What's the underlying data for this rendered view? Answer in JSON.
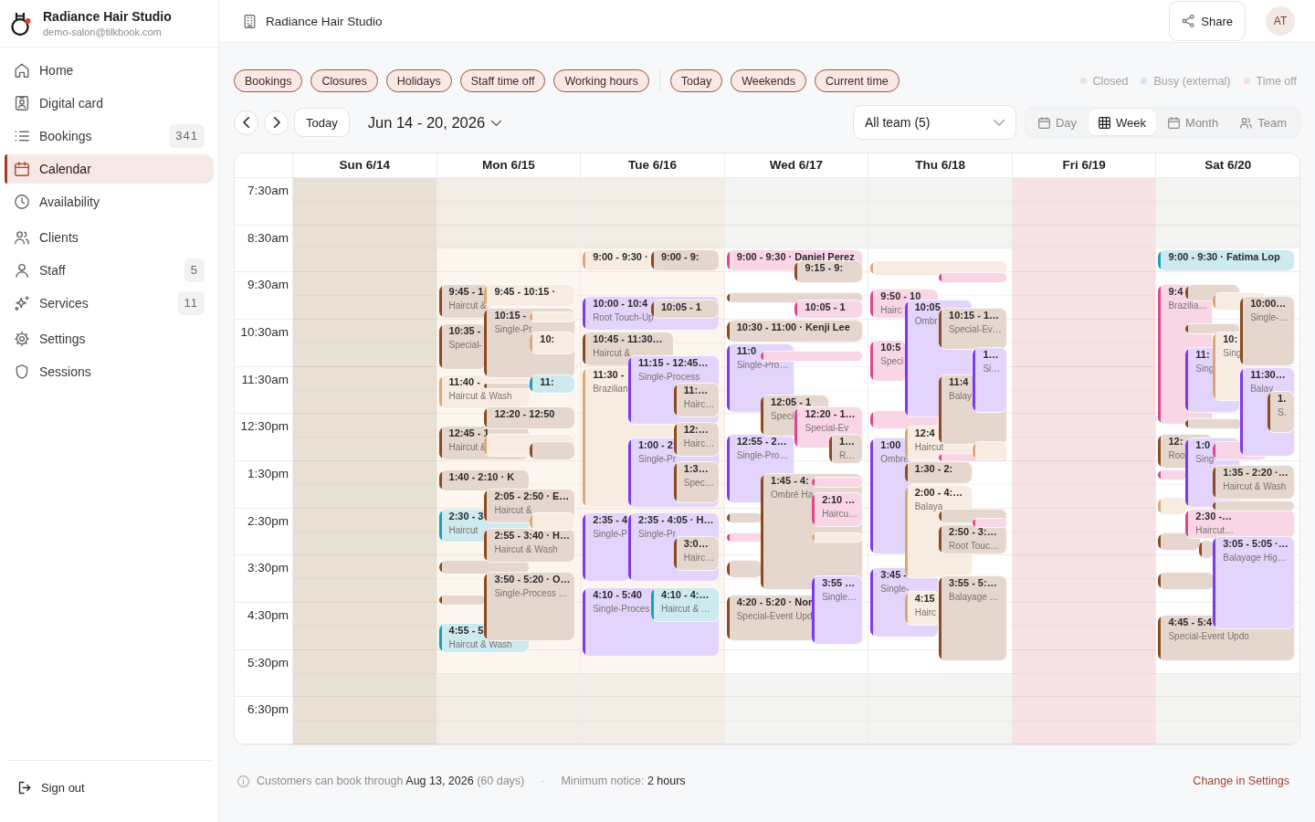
{
  "sidebar": {
    "brand": {
      "name": "Radiance Hair Studio",
      "email": "demo-salon@tilkbook.com"
    },
    "nav_groups": [
      {
        "items": [
          {
            "label": "Home",
            "selected": false
          },
          {
            "label": "Digital card",
            "selected": false
          },
          {
            "label": "Bookings",
            "count": "341",
            "selected": false
          },
          {
            "label": "Calendar",
            "selected": true
          },
          {
            "label": "Availability",
            "selected": false
          }
        ]
      },
      {
        "items": [
          {
            "label": "Clients",
            "selected": false
          },
          {
            "label": "Staff",
            "count": "5",
            "selected": false
          },
          {
            "label": "Services",
            "count": "11",
            "selected": false
          }
        ]
      },
      {
        "items": [
          {
            "label": "Settings",
            "selected": false
          },
          {
            "label": "Sessions",
            "selected": false
          }
        ]
      }
    ],
    "sign_out": "Sign out"
  },
  "topbar": {
    "title": "Radiance Hair Studio",
    "share": "Share",
    "avatar": "AT"
  },
  "filters": {
    "layers": [
      {
        "label": "Bookings",
        "on": true
      },
      {
        "label": "Closures",
        "on": true
      },
      {
        "label": "Holidays",
        "on": true
      },
      {
        "label": "Staff time off",
        "on": true
      },
      {
        "label": "Working hours",
        "on": true
      }
    ],
    "display": [
      {
        "label": "Today",
        "on": true
      },
      {
        "label": "Weekends",
        "on": true
      },
      {
        "label": "Current time",
        "on": true
      }
    ],
    "legend": [
      {
        "label": "Closed",
        "color": "#ebe4d9"
      },
      {
        "label": "Busy (external)",
        "color": "#d8e3f6"
      },
      {
        "label": "Time off",
        "color": "#f7dce2"
      }
    ]
  },
  "toolbar": {
    "today": "Today",
    "range": "Jun 14 - 20, 2026",
    "team": "All team (5)",
    "views": [
      {
        "label": "Day",
        "selected": false
      },
      {
        "label": "Week",
        "selected": true
      },
      {
        "label": "Month",
        "selected": false
      },
      {
        "label": "Team",
        "selected": false
      }
    ]
  },
  "calendar": {
    "time_slots": [
      "7:30am",
      "8:30am",
      "9:30am",
      "10:30am",
      "11:30am",
      "12:30pm",
      "1:30pm",
      "2:30pm",
      "3:30pm",
      "4:30pm",
      "5:30pm",
      "6:30pm"
    ],
    "days": [
      {
        "label": "Sun 6/14",
        "kind": "closed"
      },
      {
        "label": "Mon 6/15",
        "kind": "tinted",
        "events": [
          {
            "time": "9:45 - 1",
            "service": "Haircut &",
            "color": "#8b4a1f"
          },
          {
            "time": "9:45 - 10:15 ·",
            "color": "#d9a877"
          },
          {
            "time": "10:15 -",
            "service": "Single-Pr",
            "color": "#8b4a1f"
          },
          {
            "color": "#d9a877"
          },
          {
            "time": "10:35 -",
            "service": "Special-",
            "color": "#8b4a1f"
          },
          {
            "time": "10:",
            "color": "#d9a877"
          },
          {
            "time": "11:40 -",
            "service": "Haircut & Wash",
            "color": "#d9a877"
          },
          {
            "time": "11:",
            "color": "#1a9fb5"
          },
          {
            "color": "#8b4a1f"
          },
          {
            "time": "12:20 - 12:50",
            "color": "#8b4a1f"
          },
          {
            "time": "12:45 - 1",
            "service": "Haircut &",
            "color": "#8b4a1f"
          },
          {
            "color": "#d9a877"
          },
          {
            "color": "#8b4a1f"
          },
          {
            "time": "1:40 - 2:10 · K",
            "color": "#8b4a1f"
          },
          {
            "time": "2:05 - 2:50 · E…",
            "service": "Haircut &",
            "color": "#8b4a1f"
          },
          {
            "time": "2:30 - 3",
            "service": "Haircut",
            "color": "#1a9fb5"
          },
          {
            "color": "#d9a877"
          },
          {
            "time": "2:55 - 3:40 · H…",
            "service": "Haircut & Wash",
            "color": "#8b4a1f"
          },
          {
            "color": "#8b4a1f"
          },
          {
            "time": "3:50 - 5:20 · O…",
            "service": "Single-Process …",
            "color": "#8b4a1f"
          },
          {
            "color": "#8b4a1f"
          },
          {
            "time": "4:55 - 5",
            "service": "Haircut & Wash",
            "color": "#1a9fb5"
          }
        ]
      },
      {
        "label": "Tue 6/16",
        "kind": "tinted",
        "events": [
          {
            "time": "9:00 - 9:30 ·",
            "color": "#d9a877"
          },
          {
            "time": "9:00 - 9:",
            "color": "#8b4a1f"
          },
          {
            "time": "10:00 - 10:4",
            "service": "Root Touch-Up",
            "color": "#7c3aed"
          },
          {
            "time": "10:05 - 1",
            "color": "#8b4a1f"
          },
          {
            "time": "10:45 - 11:30…",
            "service": "Haircut &",
            "color": "#8b4a1f"
          },
          {
            "time": "11:15 - 12:45…",
            "service": "Single-Process",
            "color": "#7c3aed"
          },
          {
            "time": "11:30 -",
            "service": "Brazilian",
            "color": "#d9a877"
          },
          {
            "time": "11:…",
            "service": "Hairc…",
            "color": "#8b4a1f"
          },
          {
            "time": "12:…",
            "service": "Hairc…",
            "color": "#8b4a1f"
          },
          {
            "time": "1:00 - 2",
            "service": "Single-Pr",
            "color": "#7c3aed"
          },
          {
            "time": "1:3…",
            "service": "Spec…",
            "color": "#8b4a1f"
          },
          {
            "time": "2:35 - 4",
            "service": "Single-P",
            "color": "#7c3aed"
          },
          {
            "time": "2:35 - 4:05 · H…",
            "service": "Single-Pr",
            "color": "#7c3aed"
          },
          {
            "time": "3:0…",
            "service": "Hairc…",
            "color": "#8b4a1f"
          },
          {
            "time": "4:10 - 5:40",
            "service": "Single-Proces",
            "color": "#7c3aed"
          },
          {
            "time": "4:10 - 4:…",
            "service": "Haircut & …",
            "color": "#1a9fb5"
          }
        ]
      },
      {
        "label": "Wed 6/17",
        "kind": "open",
        "events": [
          {
            "time": "9:00 - 9:30 · Daniel Perez",
            "color": "#e0458d"
          },
          {
            "time": "9:15 - 9:",
            "color": "#8b4a1f"
          },
          {
            "color": "#8b4a1f"
          },
          {
            "time": "10:05 - 1",
            "color": "#e0458d"
          },
          {
            "time": "10:30 - 11:00 · Kenji Lee",
            "color": "#8b4a1f"
          },
          {
            "time": "11:0",
            "service": "Single-Pro…",
            "color": "#7c3aed"
          },
          {
            "color": "#e0458d"
          },
          {
            "time": "12:05 - 1",
            "service": "Speci",
            "color": "#8b4a1f"
          },
          {
            "time": "12:20 - 1…",
            "service": "Special-Ev",
            "color": "#e0458d"
          },
          {
            "time": "12:55 - 2…",
            "service": "Single-Pro…",
            "color": "#7c3aed"
          },
          {
            "time": "1…",
            "service": "R…",
            "color": "#8b4a1f"
          },
          {
            "time": "1:45 - 4:",
            "service": "Ombré Ha",
            "color": "#8b4a1f"
          },
          {
            "color": "#e0458d"
          },
          {
            "time": "2:10 …",
            "service": "Haircu…",
            "color": "#e0458d"
          },
          {
            "color": "#8b4a1f"
          },
          {
            "color": "#e0458d"
          },
          {
            "color": "#d9a877"
          },
          {
            "color": "#8b4a1f"
          },
          {
            "time": "3:55 …",
            "service": "Single…",
            "color": "#7c3aed"
          },
          {
            "time": "4:20 - 5:20 · Nor",
            "service": "Special-Event Upd",
            "color": "#8b4a1f"
          }
        ]
      },
      {
        "label": "Thu 6/18",
        "kind": "open",
        "events": [
          {
            "color": "#d9a877"
          },
          {
            "color": "#e0458d"
          },
          {
            "time": "9:50 - 10",
            "service": "Hairc",
            "color": "#e0458d"
          },
          {
            "time": "10:05",
            "service": "Ombr",
            "color": "#7c3aed"
          },
          {
            "time": "10:15 - 1…",
            "service": "Special-Ev…",
            "color": "#8b4a1f"
          },
          {
            "time": "10:5",
            "service": "Speci",
            "color": "#e0458d"
          },
          {
            "time": "1…",
            "service": "Si…",
            "color": "#7c3aed"
          },
          {
            "time": "11:4",
            "service": "Balay",
            "color": "#8b4a1f"
          },
          {
            "color": "#e0458d"
          },
          {
            "time": "12:4",
            "service": "Haircut",
            "color": "#d9a877"
          },
          {
            "time": "1:00",
            "service": "Ombré",
            "color": "#7c3aed"
          },
          {
            "color": "#d9a877"
          },
          {
            "color": "#e0458d"
          },
          {
            "time": "1:30 - 2:",
            "color": "#8b4a1f"
          },
          {
            "time": "2:00 - 4:…",
            "service": "Balaya",
            "color": "#d9a877"
          },
          {
            "color": "#8b4a1f"
          },
          {
            "color": "#e0458d"
          },
          {
            "time": "2:50 - 3:…",
            "service": "Root Touc…",
            "color": "#8b4a1f"
          },
          {
            "time": "3:45 -",
            "service": "Single-",
            "color": "#7c3aed"
          },
          {
            "time": "3:55 - 5:…",
            "service": "Balayage …",
            "color": "#8b4a1f"
          },
          {
            "time": "4:15",
            "service": "Hairc",
            "color": "#d9a877"
          }
        ]
      },
      {
        "label": "Fri 6/19",
        "kind": "timeoff"
      },
      {
        "label": "Sat 6/20",
        "kind": "open",
        "events": [
          {
            "time": "9:00 - 9:30 · Fatima Lop",
            "color": "#1a9fb5"
          },
          {
            "time": "9:4",
            "service": "Brazilia…",
            "color": "#e0458d"
          },
          {
            "color": "#8b4a1f"
          },
          {
            "color": "#d9a877"
          },
          {
            "time": "10:00…",
            "service": "Single-…",
            "color": "#8b4a1f"
          },
          {
            "color": "#8b4a1f"
          },
          {
            "time": "10:",
            "service": "Sing",
            "color": "#d9a877"
          },
          {
            "time": "11:",
            "service": "Sing",
            "color": "#7c3aed"
          },
          {
            "time": "11:30…",
            "service": "Balay",
            "color": "#7c3aed"
          },
          {
            "time": "1.",
            "service": "S.",
            "color": "#8b4a1f"
          },
          {
            "color": "#8b4a1f"
          },
          {
            "time": "12:",
            "service": "Roo",
            "color": "#8b4a1f"
          },
          {
            "time": "1:0",
            "service": "Sing",
            "color": "#7c3aed"
          },
          {
            "color": "#e0458d"
          },
          {
            "time": "1:35 - 2:20 ·…",
            "service": "Haircut & Wash",
            "color": "#8b4a1f"
          },
          {
            "color": "#e0458d"
          },
          {
            "color": "#d9a877"
          },
          {
            "color": "#8b4a1f"
          },
          {
            "time": "2:30 -…",
            "service": "Haircut…",
            "color": "#e0458d"
          },
          {
            "color": "#8b4a1f"
          },
          {
            "time": "3:05 - 5:05 ·…",
            "service": "Balayage Hig…",
            "color": "#7c3aed"
          },
          {
            "color": "#8b4a1f"
          },
          {
            "color": "#8b4a1f"
          },
          {
            "time": "4:45 - 5:4",
            "service": "Special-Event Updo",
            "color": "#8b4a1f"
          }
        ]
      }
    ]
  },
  "footer": {
    "booking_window": "Customers can book through **Aug 13, 2026** (60 days)",
    "separator": "·",
    "notice": "Minimum notice: **2 hours**",
    "link": "Change in Settings"
  }
}
